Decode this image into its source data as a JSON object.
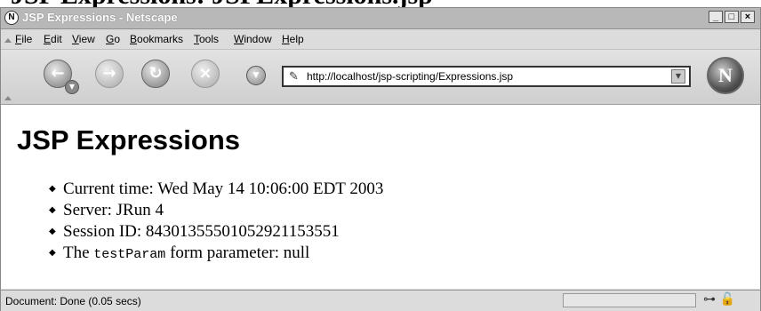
{
  "page_header": "JSP Expressions: JSPExpressions.jsp",
  "window": {
    "title": "JSP Expressions - Netscape"
  },
  "menu": [
    "File",
    "Edit",
    "View",
    "Go",
    "Bookmarks",
    "Tools",
    "Window",
    "Help"
  ],
  "nav": {
    "url": "http://localhost/jsp-scripting/Expressions.jsp"
  },
  "content": {
    "heading": "JSP Expressions",
    "items": [
      {
        "label": "Current time: ",
        "value": "Wed May 14 10:06:00 EDT 2003"
      },
      {
        "label": "Server: ",
        "value": "JRun 4"
      },
      {
        "label": "Session ID: ",
        "value": "84301355501052921153551"
      }
    ],
    "param_item": {
      "prefix": "The ",
      "code": "testParam",
      "suffix": " form parameter: null"
    }
  },
  "status": {
    "text": "Document: Done (0.05 secs)"
  }
}
